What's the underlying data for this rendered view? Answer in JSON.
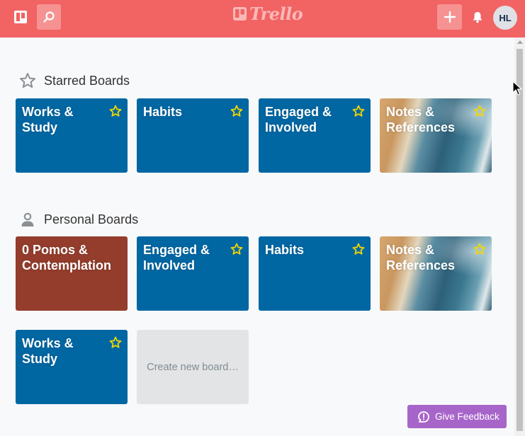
{
  "header": {
    "logo_text": "Trello",
    "avatar_initials": "HL",
    "icons": [
      "boards-icon",
      "search-icon",
      "plus-icon",
      "bell-icon"
    ],
    "bg_color": "#f26363"
  },
  "starred": {
    "title": "Starred Boards",
    "boards": [
      {
        "name": "Works & Study",
        "bg": "blue",
        "starred": true
      },
      {
        "name": "Habits",
        "bg": "blue",
        "starred": true
      },
      {
        "name": "Engaged & Involved",
        "bg": "blue",
        "starred": true
      },
      {
        "name": "Notes & References",
        "bg": "beach",
        "starred": true
      }
    ]
  },
  "personal": {
    "title": "Personal Boards",
    "boards": [
      {
        "name": "0 Pomos & Contemplation",
        "bg": "red",
        "starred": false
      },
      {
        "name": "Engaged & Involved",
        "bg": "blue",
        "starred": true
      },
      {
        "name": "Habits",
        "bg": "blue",
        "starred": true
      },
      {
        "name": "Notes & References",
        "bg": "beach",
        "starred": true
      },
      {
        "name": "Works & Study",
        "bg": "blue",
        "starred": true
      }
    ],
    "create_label": "Create new board…"
  },
  "feedback": {
    "label": "Give Feedback"
  },
  "colors": {
    "blue": "#0067a3",
    "red": "#943d2c",
    "star": "#f2d600",
    "feedback": "#a865c9"
  }
}
